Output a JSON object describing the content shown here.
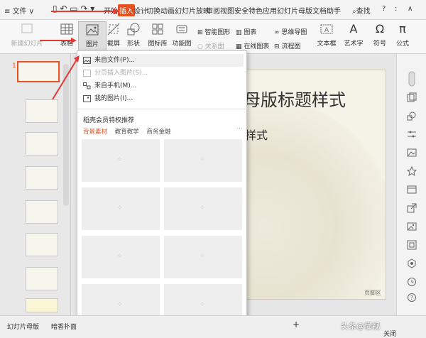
{
  "topbar": {
    "menu_label": "文件",
    "tabs": [
      "开始",
      "插入",
      "设计",
      "切换",
      "动画",
      "幻灯片放映",
      "审阅",
      "视图",
      "安全",
      "特色应用",
      "幻灯片母版",
      "文档助手"
    ],
    "search_label": "查找",
    "help": "?",
    "colon": ":",
    "chevron_up": "∧"
  },
  "ribbon": {
    "new_slide": "新建幻灯片",
    "table": "表格",
    "picture": "图片",
    "screenshot": "截屏",
    "shape": "形状",
    "icon_lib": "图标库",
    "func_chart": "功能图",
    "smart_shape": "智能图形",
    "chart": "图表",
    "mind_map": "思维导图",
    "relation": "关系图",
    "online_chart": "在线图表",
    "flowchart": "流程图",
    "textbox": "文本框",
    "art_text": "艺术字",
    "symbol": "符号",
    "formula": "公式",
    "symbol_glyph": "Ω",
    "formula_glyph": "π",
    "art_glyph": "A"
  },
  "picture_menu": {
    "items": [
      {
        "label": "来自文件(P)...",
        "enabled": true
      },
      {
        "label": "分页插入图片(S)...",
        "enabled": false
      },
      {
        "label": "来自手机(M)...",
        "enabled": true
      },
      {
        "label": "我的图片(I)...",
        "enabled": true
      }
    ],
    "section_title": "稻壳会员特权推荐",
    "tabs": [
      "背景素材",
      "教育教学",
      "商务金融"
    ],
    "more": "···",
    "spinner": "⁘"
  },
  "slide_panel": {
    "first_number": "1"
  },
  "slide": {
    "title": "母版标题样式",
    "subtitle": "样式",
    "footer": "页脚区"
  },
  "statusbar": {
    "left_tab": "幻灯片母版",
    "middle_tab": "暗香扑面",
    "plus": "+",
    "watermark": "头条@懂视",
    "close": "关闭"
  },
  "colors": {
    "accent": "#e8501f",
    "arrow": "#e53935"
  }
}
